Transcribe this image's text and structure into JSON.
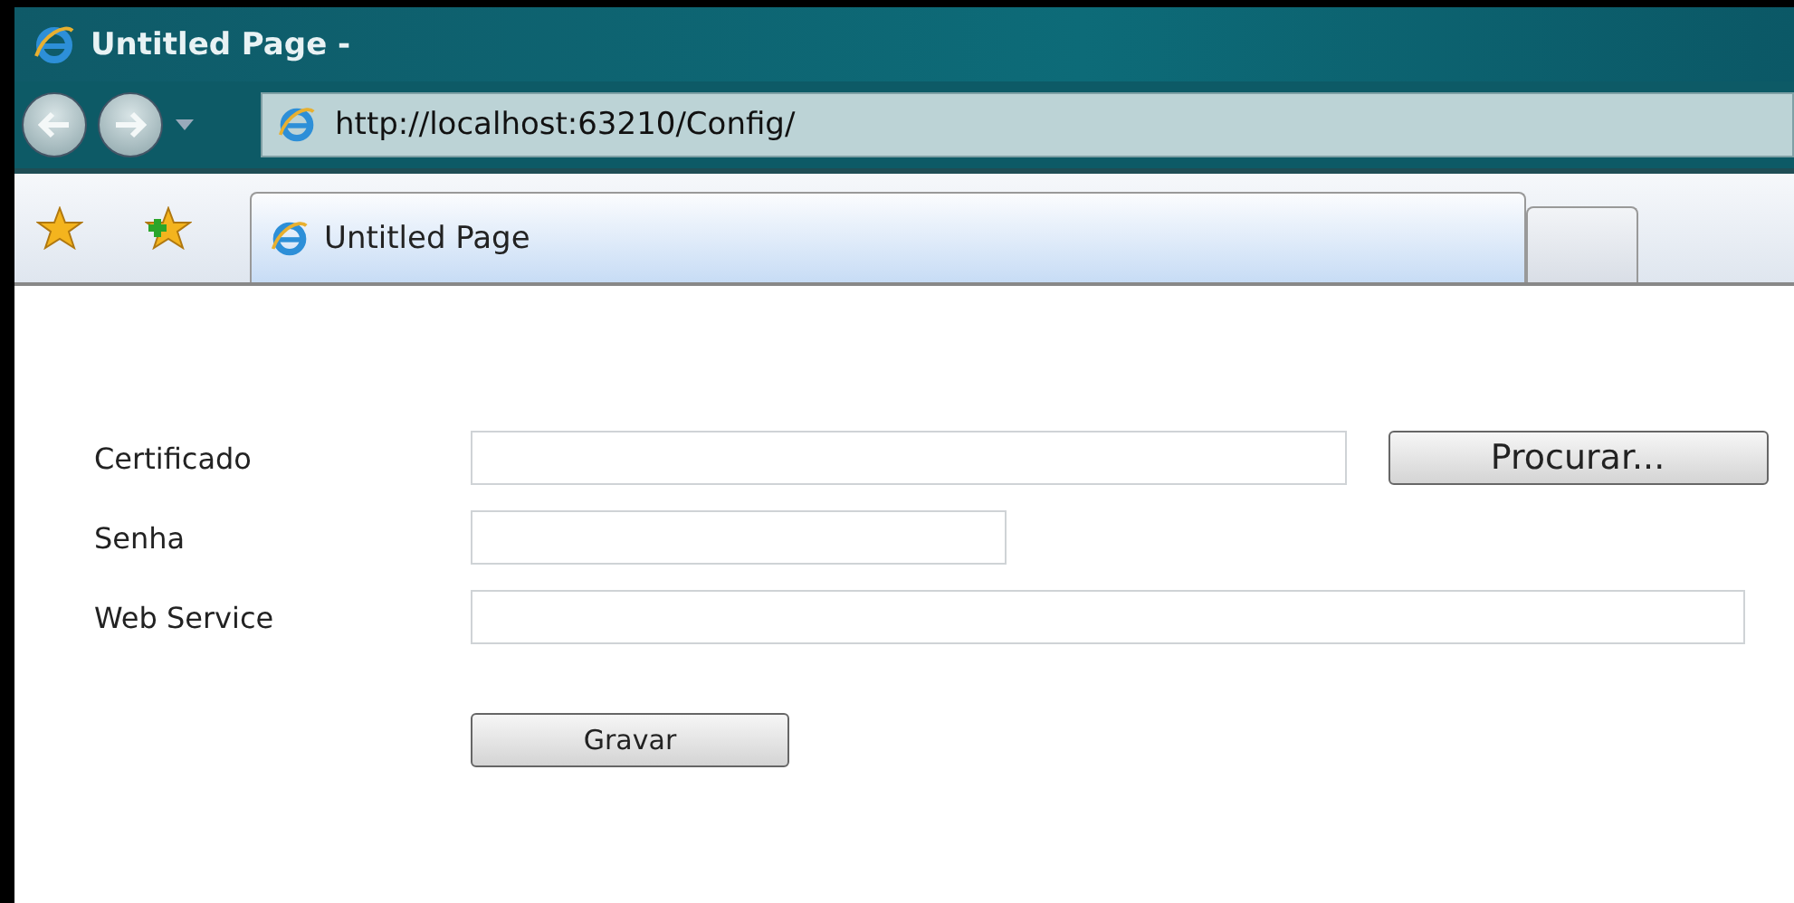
{
  "window": {
    "title": "Untitled Page -"
  },
  "address_bar": {
    "url": "http://localhost:63210/Config/"
  },
  "tabs": [
    {
      "label": "Untitled Page",
      "selected": true
    },
    {
      "selected": false
    }
  ],
  "form": {
    "fields": [
      {
        "label": "Certificado",
        "kind": "file",
        "button": "Procurar..."
      },
      {
        "label": "Senha",
        "kind": "text"
      },
      {
        "label": "Web Service",
        "kind": "wide"
      }
    ],
    "submit": "Gravar"
  }
}
